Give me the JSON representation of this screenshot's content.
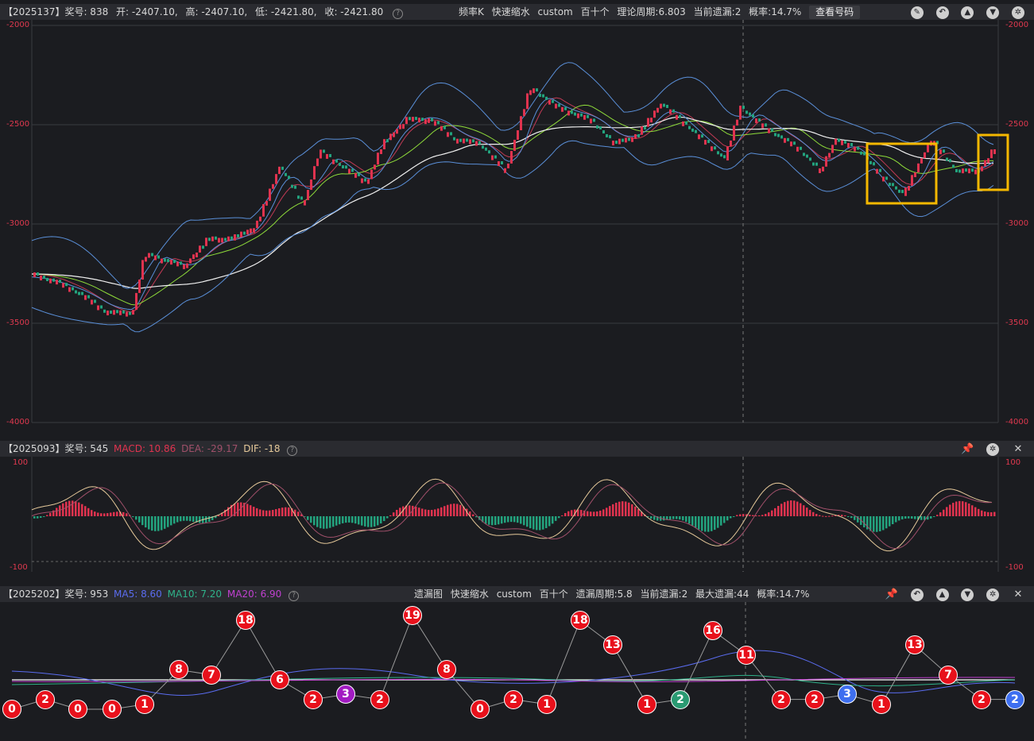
{
  "main": {
    "header": {
      "issue": "【2025137】",
      "count": "奖号: 838",
      "open": "开: -2407.10,",
      "high": "高: -2407.10,",
      "low": "低: -2421.80,",
      "close": "收: -2421.80",
      "center": [
        "频率K",
        "快速缩水",
        "custom",
        "百十个",
        "理论周期:6.803",
        "当前遗漏:2",
        "概率:14.7%"
      ],
      "view_button": "查看号码"
    },
    "axis_left": [
      "-2000",
      "-2500",
      "-3000",
      "-3500",
      "-4000"
    ],
    "axis_right": [
      "-2000",
      "-2500",
      "-3000",
      "-3500",
      "-4000"
    ]
  },
  "macd": {
    "header": {
      "issue": "【2025093】",
      "count": "奖号: 545",
      "macd": "MACD: 10.86",
      "dea": "DEA: -29.17",
      "dif": "DIF: -18"
    },
    "axis_left": [
      "100",
      "-100"
    ],
    "axis_right": [
      "100",
      "-100"
    ]
  },
  "omit": {
    "header": {
      "issue": "【2025202】",
      "count": "奖号: 953",
      "ma5": "MA5: 8.60",
      "ma10": "MA10: 7.20",
      "ma20": "MA20: 6.90",
      "center": [
        "遗漏图",
        "快速缩水",
        "custom",
        "百十个",
        "遗漏周期:5.8",
        "当前遗漏:2",
        "最大遗漏:44",
        "概率:14.7%"
      ]
    },
    "nodes": [
      {
        "v": "0",
        "c": "red"
      },
      {
        "v": "2",
        "c": "red"
      },
      {
        "v": "0",
        "c": "red"
      },
      {
        "v": "0",
        "c": "red"
      },
      {
        "v": "1",
        "c": "red"
      },
      {
        "v": "8",
        "c": "red"
      },
      {
        "v": "7",
        "c": "red"
      },
      {
        "v": "18",
        "c": "red"
      },
      {
        "v": "6",
        "c": "red"
      },
      {
        "v": "2",
        "c": "red"
      },
      {
        "v": "3",
        "c": "purple"
      },
      {
        "v": "2",
        "c": "red"
      },
      {
        "v": "19",
        "c": "red"
      },
      {
        "v": "8",
        "c": "red"
      },
      {
        "v": "0",
        "c": "red"
      },
      {
        "v": "2",
        "c": "red"
      },
      {
        "v": "1",
        "c": "red"
      },
      {
        "v": "18",
        "c": "red"
      },
      {
        "v": "13",
        "c": "red"
      },
      {
        "v": "1",
        "c": "red"
      },
      {
        "v": "2",
        "c": "green"
      },
      {
        "v": "16",
        "c": "red"
      },
      {
        "v": "11",
        "c": "red"
      },
      {
        "v": "2",
        "c": "red"
      },
      {
        "v": "2",
        "c": "red"
      },
      {
        "v": "3",
        "c": "blue"
      },
      {
        "v": "1",
        "c": "red"
      },
      {
        "v": "13",
        "c": "red"
      },
      {
        "v": "7",
        "c": "red"
      },
      {
        "v": "2",
        "c": "red"
      },
      {
        "v": "2",
        "c": "blue"
      }
    ]
  },
  "colors": {
    "up": "#e0334f",
    "down": "#23a37e",
    "node_red": "#e8101b",
    "node_purple": "#a21bc2",
    "node_green": "#2a9a72",
    "node_blue": "#3e6ff0",
    "highlight": "#f5b800"
  },
  "icons": {
    "main": [
      "pencil-icon",
      "undo-icon",
      "up-icon",
      "down-icon",
      "settings-icon"
    ],
    "macd": [
      "pin-icon",
      "settings-icon",
      "close-icon"
    ],
    "omit": [
      "pin-icon",
      "undo-icon",
      "up-icon",
      "down-icon",
      "settings-icon",
      "close-icon"
    ]
  }
}
